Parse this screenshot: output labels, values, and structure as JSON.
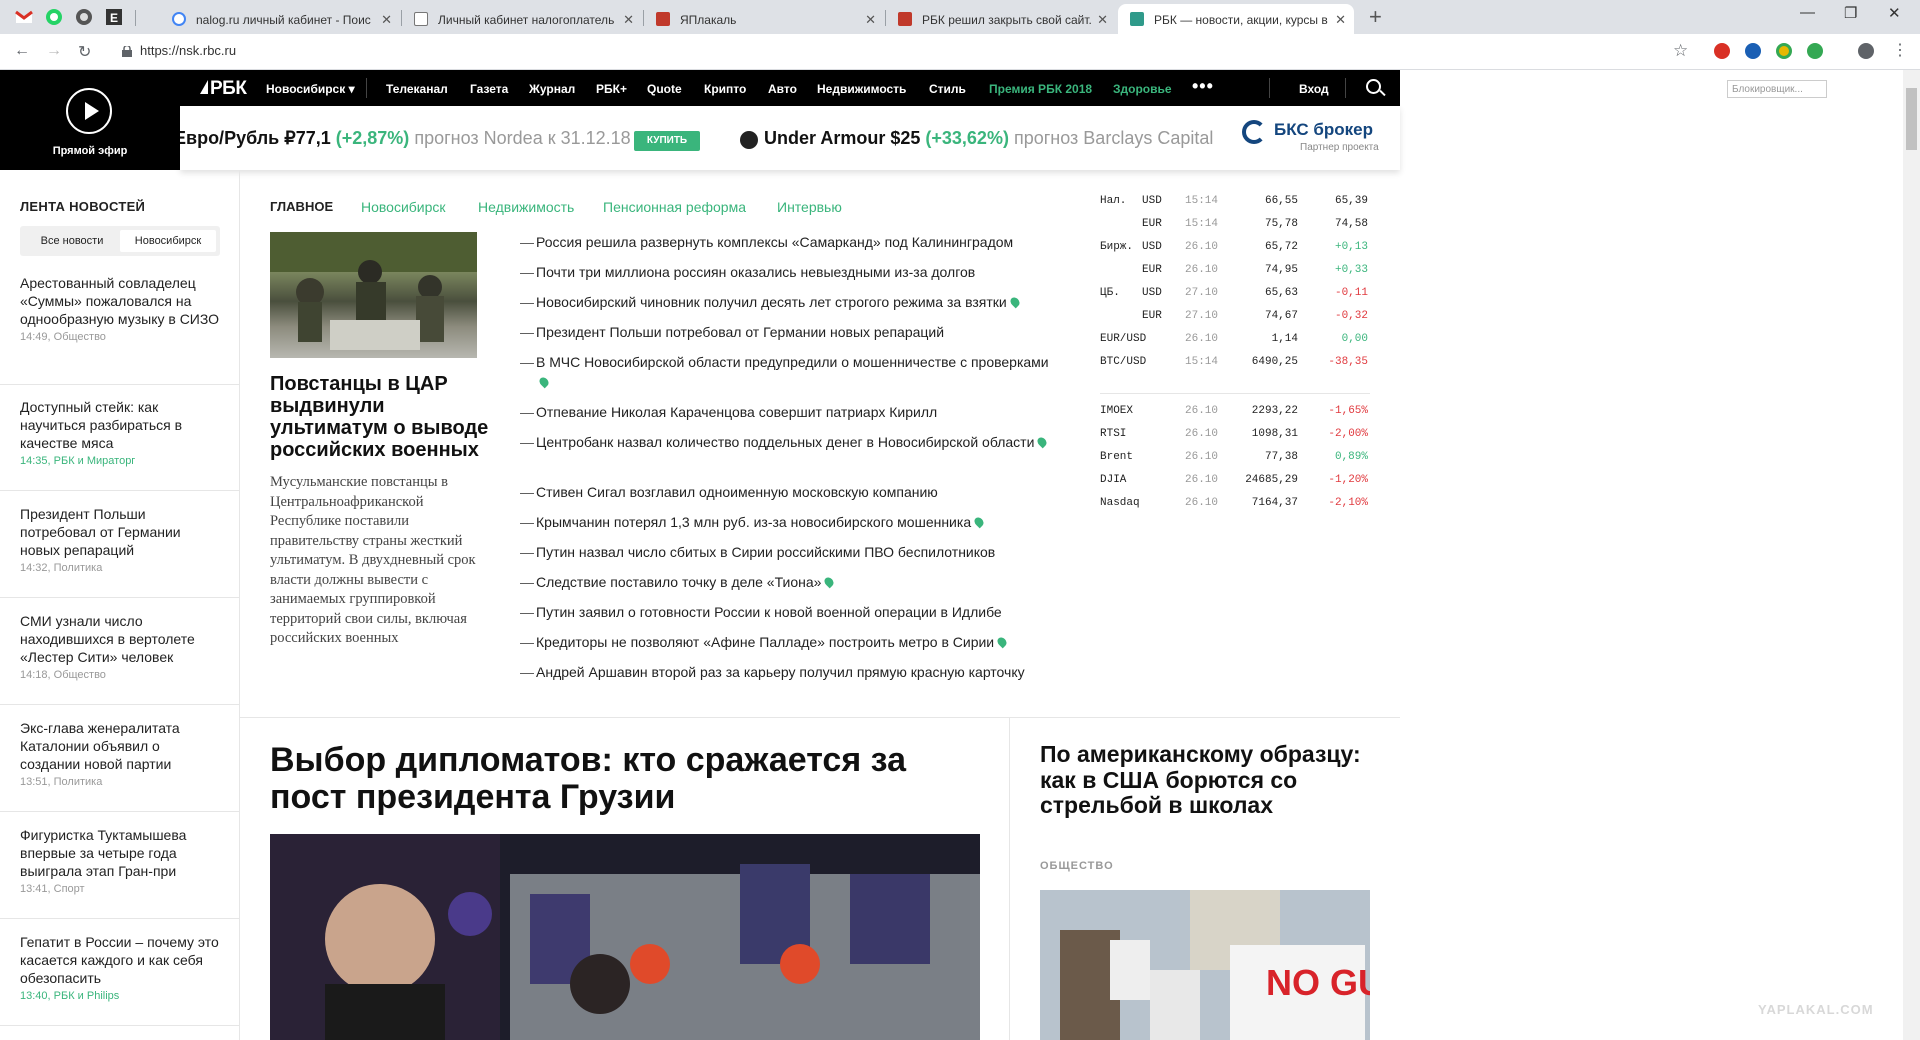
{
  "browser": {
    "tabs": [
      {
        "title": "nalog.ru личный кабинет - Поис",
        "color": "#4285f4"
      },
      {
        "title": "Личный кабинет налогоплатель",
        "color": "#777777"
      },
      {
        "title": "ЯПлакаль",
        "color": "#c0392b"
      },
      {
        "title": "РБК решил закрыть свой сайт. ",
        "color": "#c0392b"
      },
      {
        "title": "РБК — новости, акции, курсы в",
        "color": "#2f9a8a"
      }
    ],
    "url": "https://nsk.rbc.ru",
    "blocker_label": "Блокировщик..."
  },
  "live": {
    "label": "Прямой эфир"
  },
  "nav": {
    "logo": "РБК",
    "city": "Новосибирск ▾",
    "items": [
      "Телеканал",
      "Газета",
      "Журнал",
      "РБК+",
      "Quote",
      "Крипто",
      "Авто",
      "Недвижимость",
      "Стиль"
    ],
    "green_items": [
      "Премия РБК 2018",
      "Здоровье"
    ],
    "more": "•••",
    "login": "Вход"
  },
  "ticker": {
    "item1": {
      "name": "Евро/Рубль ₽77,1",
      "change": "(+2,87%)",
      "forecast": "прогноз Nordea к 31.12.18"
    },
    "buy": "КУПИТЬ",
    "item2": {
      "name": "Under Armour $25",
      "change": "(+33,62%)",
      "forecast": "прогноз Barclays Capital"
    },
    "partner": {
      "name": "БКС брокер",
      "sub": "Партнер проекта"
    }
  },
  "feed": {
    "heading": "ЛЕНТА НОВОСТЕЙ",
    "tab_all": "Все новости",
    "tab_city": "Новосибирск",
    "items": [
      {
        "title": "Арестованный совладелец «Суммы» пожаловался на однообразную музыку в СИЗО",
        "meta": "14:49, Общество"
      },
      {
        "title": "Доступный стейк: как научиться разбираться в качестве мяса",
        "meta": "14:35, РБК и Мираторг"
      },
      {
        "title": "Президент Польши потребовал от Германии новых репараций",
        "meta": "14:32, Политика"
      },
      {
        "title": "СМИ узнали число находившихся в вертолете «Лестер Сити» человек",
        "meta": "14:18, Общество"
      },
      {
        "title": "Экс-глава женералитата Каталонии объявил о создании новой партии",
        "meta": "13:51, Политика"
      },
      {
        "title": "Фигуристка Туктамышева впервые за четыре года выиграла этап Гран-при",
        "meta": "13:41, Спорт"
      },
      {
        "title": "Гепатит в России – почему это касается каждого и как себя обезопасить",
        "meta": "13:40, РБК и Philips"
      }
    ]
  },
  "sections": [
    "ГЛАВНОЕ",
    "Новосибирск",
    "Недвижимость",
    "Пенсионная реформа",
    "Интервью"
  ],
  "lead": {
    "title": "Повстанцы в ЦАР выдвинули ультиматум о выводе российских военных",
    "text": "Мусульманские повстанцы в Центральноафриканской Республике поставили правительству страны жесткий ультиматум. В двухдневный срок власти должны вывести с занимаемых группировкой территорий свои силы, включая российских военных"
  },
  "headlines": [
    {
      "text": "Россия решила развернуть комплексы «Самарканд» под Калининградом",
      "pin": false
    },
    {
      "text": "Почти три миллиона россиян оказались невыездными из-за долгов",
      "pin": false
    },
    {
      "text": "Новосибирский чиновник получил десять лет строгого режима за взятки",
      "pin": true
    },
    {
      "text": "Президент Польши потребовал от Германии новых репараций",
      "pin": false
    },
    {
      "text": "В МЧС Новосибирской области предупредили о мошенничестве с проверками",
      "pin": true
    },
    {
      "text": "Отпевание Николая Караченцова совершит патриарх Кирилл",
      "pin": false
    },
    {
      "text": "Центробанк назвал количество поддельных денег в Новосибирской области",
      "pin": true
    },
    {
      "text": "Стивен Сигал возглавил одноименную московскую компанию",
      "pin": false
    },
    {
      "text": "Крымчанин потерял 1,3 млн руб. из-за новосибирского мошенника",
      "pin": true
    },
    {
      "text": "Путин назвал число сбитых в Сирии российскими ПВО беспилотников",
      "pin": false
    },
    {
      "text": "Следствие поставило точку в деле «Тиона»",
      "pin": true
    },
    {
      "text": "Путин заявил о готовности России к новой военной операции в Идлибе",
      "pin": false
    },
    {
      "text": "Кредиторы не позволяют «Афине Палладе» построить метро в Сирии",
      "pin": true
    },
    {
      "text": "Андрей Аршавин второй раз за карьеру получил прямую красную карточку",
      "pin": false
    }
  ],
  "quotes": {
    "currency": [
      {
        "group": "Нал.",
        "code": "USD",
        "time": "15:14",
        "v1": "66,55",
        "v2": "65,39",
        "v2color": "#222222"
      },
      {
        "group": "",
        "code": "EUR",
        "time": "15:14",
        "v1": "75,78",
        "v2": "74,58",
        "v2color": "#222222"
      },
      {
        "group": "Бирж.",
        "code": "USD",
        "time": "26.10",
        "v1": "65,72",
        "v2": "+0,13",
        "v2color": "#3ab57c"
      },
      {
        "group": "",
        "code": "EUR",
        "time": "26.10",
        "v1": "74,95",
        "v2": "+0,33",
        "v2color": "#3ab57c"
      },
      {
        "group": "ЦБ.",
        "code": "USD",
        "time": "27.10",
        "v1": "65,63",
        "v2": "-0,11",
        "v2color": "#e0393e"
      },
      {
        "group": "",
        "code": "EUR",
        "time": "27.10",
        "v1": "74,67",
        "v2": "-0,32",
        "v2color": "#e0393e"
      },
      {
        "group": "EUR/USD",
        "code": "",
        "time": "26.10",
        "v1": "1,14",
        "v2": "0,00",
        "v2color": "#3ab57c"
      },
      {
        "group": "BTC/USD",
        "code": "",
        "time": "15:14",
        "v1": "6490,25",
        "v2": "-38,35",
        "v2color": "#e0393e"
      }
    ],
    "indices": [
      {
        "name": "IMOEX",
        "time": "26.10",
        "v1": "2293,22",
        "v2": "-1,65%",
        "v2color": "#e0393e"
      },
      {
        "name": "RTSI",
        "time": "26.10",
        "v1": "1098,31",
        "v2": "-2,00%",
        "v2color": "#e0393e"
      },
      {
        "name": "Brent",
        "time": "26.10",
        "v1": "77,38",
        "v2": "0,89%",
        "v2color": "#3ab57c"
      },
      {
        "name": "DJIA",
        "time": "26.10",
        "v1": "24685,29",
        "v2": "-1,20%",
        "v2color": "#e0393e"
      },
      {
        "name": "Nasdaq",
        "time": "26.10",
        "v1": "7164,37",
        "v2": "-2,10%",
        "v2color": "#e0393e"
      }
    ]
  },
  "feature": {
    "title": "Выбор дипломатов: кто сражается за пост президента Грузии"
  },
  "side": {
    "title": "По американскому образцу: как в США борются со стрельбой в школах",
    "category": "ОБЩЕСТВО",
    "sign_text": "NO GUNS"
  },
  "watermark": "YAPLAKAL.COM",
  "colors": {
    "accent_green": "#3ab57c",
    "negative_red": "#e0393e",
    "nav_black": "#000000"
  }
}
